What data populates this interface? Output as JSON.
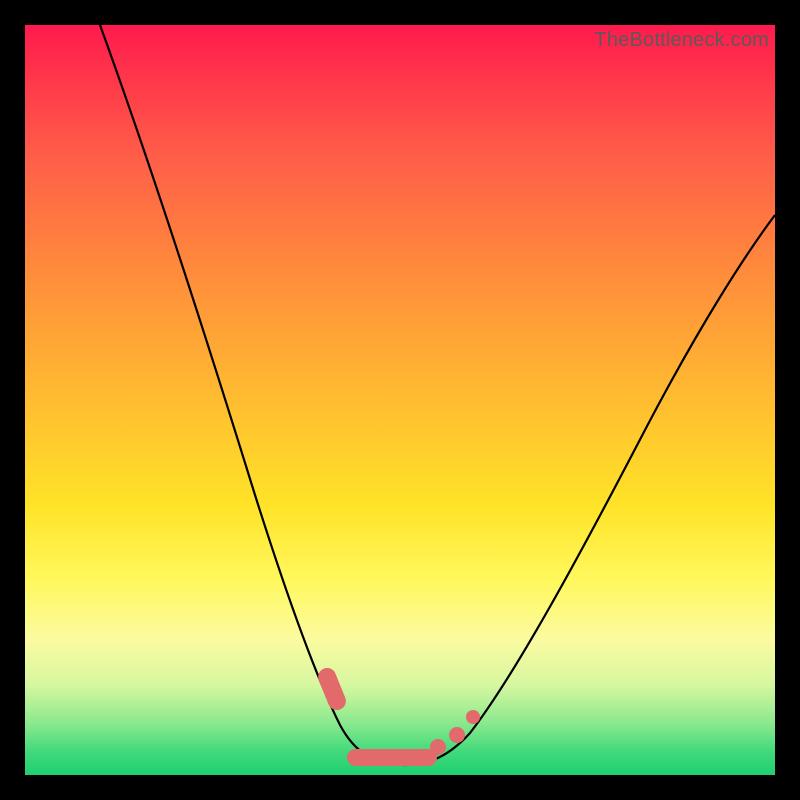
{
  "watermark": "TheBottleneck.com",
  "colors": {
    "frame": "#000000",
    "curve": "#000000",
    "bumps": "#e26a6a",
    "gradient_top": "#ff1a4d",
    "gradient_bottom": "#1ed06e"
  },
  "chart_data": {
    "type": "line",
    "title": "",
    "xlabel": "",
    "ylabel": "",
    "xlim": [
      0,
      100
    ],
    "ylim": [
      0,
      100
    ],
    "note": "No axis ticks or numeric labels are shown; values below are read as percentages of the plot area (x left→right, y bottom→top).",
    "series": [
      {
        "name": "bottleneck-curve",
        "x": [
          10,
          15,
          20,
          25,
          30,
          35,
          38,
          41,
          44,
          47,
          50,
          53,
          56,
          60,
          65,
          70,
          75,
          80,
          85,
          90,
          100
        ],
        "y": [
          100,
          87,
          74,
          61,
          48,
          35,
          25,
          16,
          9,
          4,
          2,
          2,
          3,
          5,
          10,
          18,
          28,
          38,
          47,
          54,
          66
        ]
      }
    ],
    "annotations": [
      {
        "name": "valley-bump-left",
        "x": 41,
        "y": 12,
        "shape": "capsule"
      },
      {
        "name": "valley-bump-floor",
        "x": 50,
        "y": 3,
        "shape": "long-capsule"
      },
      {
        "name": "valley-bump-right-low",
        "x": 57,
        "y": 6,
        "shape": "dot"
      },
      {
        "name": "valley-bump-right-high",
        "x": 59,
        "y": 9,
        "shape": "dot"
      }
    ]
  }
}
